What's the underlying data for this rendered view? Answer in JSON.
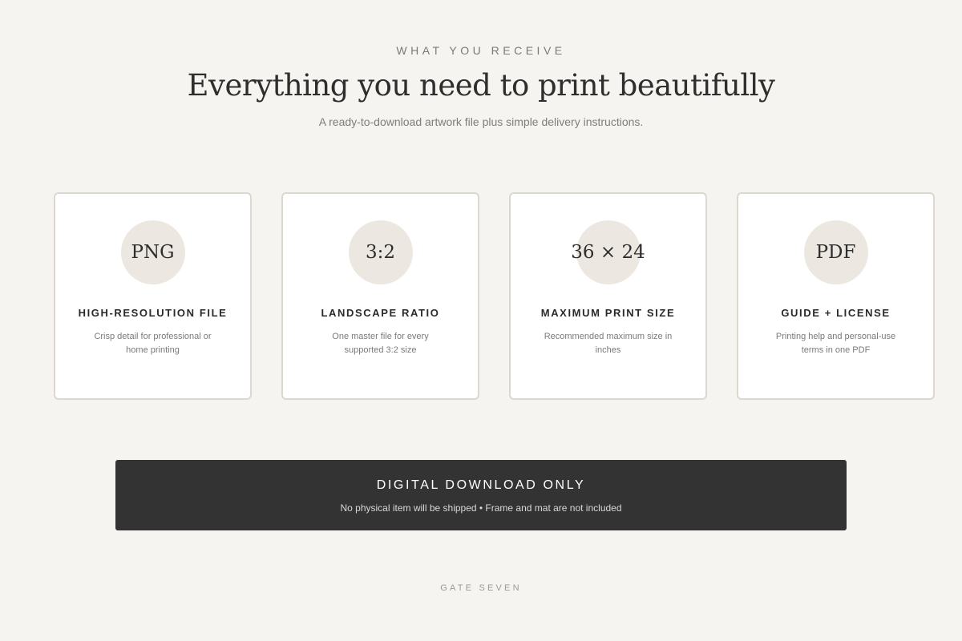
{
  "header": {
    "eyebrow": "WHAT YOU RECEIVE",
    "title": "Everything you need to print beautifully",
    "subtitle": "A ready-to-download artwork file plus simple delivery instructions."
  },
  "cards": [
    {
      "badge": "PNG",
      "title": "HIGH-RESOLUTION FILE",
      "description": "Crisp detail for professional or home printing"
    },
    {
      "badge": "3:2",
      "title": "LANDSCAPE RATIO",
      "description": "One master file for every supported 3:2 size"
    },
    {
      "badge": "36 × 24",
      "title": "MAXIMUM PRINT SIZE",
      "description": "Recommended maximum size in inches"
    },
    {
      "badge": "PDF",
      "title": "GUIDE + LICENSE",
      "description": "Printing help and personal-use terms in one PDF"
    }
  ],
  "banner": {
    "title": "DIGITAL DOWNLOAD ONLY",
    "text": "No physical item will be shipped • Frame and mat are not included"
  },
  "footer": {
    "brand": "GATE SEVEN"
  },
  "colors": {
    "background": "#f5f4f0",
    "card_border": "#dcd8d0",
    "badge_fill": "#ece8e1",
    "banner_fill": "#333333"
  }
}
